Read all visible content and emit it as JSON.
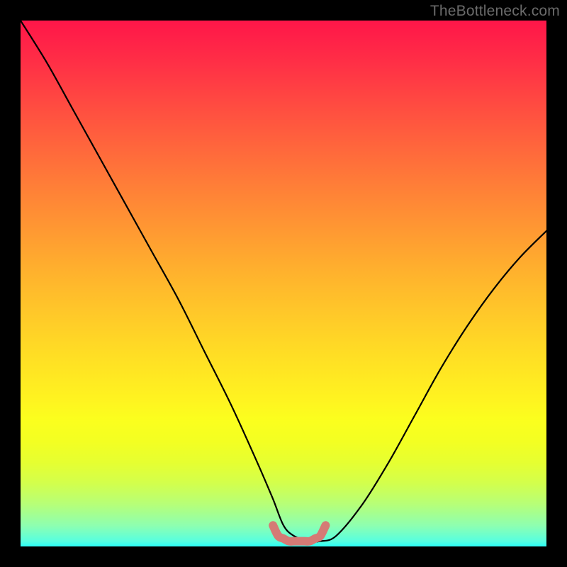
{
  "watermark": "TheBottleneck.com",
  "colors": {
    "frame": "#000000",
    "curve": "#000000",
    "bottom_hump": "#d57a75",
    "gradient_top": "#ff1649",
    "gradient_bottom": "#2cfff7"
  },
  "chart_data": {
    "type": "line",
    "title": "",
    "xlabel": "",
    "ylabel": "",
    "xlim": [
      0,
      100
    ],
    "ylim": [
      0,
      100
    ],
    "grid": false,
    "series": [
      {
        "name": "bottleneck-curve",
        "x": [
          0,
          5,
          10,
          15,
          20,
          25,
          30,
          35,
          40,
          45,
          48,
          50,
          52,
          55,
          57,
          60,
          65,
          70,
          75,
          80,
          85,
          90,
          95,
          100
        ],
        "values": [
          100,
          92,
          83,
          74,
          65,
          56,
          47,
          37,
          27,
          16,
          9,
          4,
          2,
          1,
          1,
          2,
          8,
          16,
          25,
          34,
          42,
          49,
          55,
          60
        ]
      },
      {
        "name": "bottom-hump",
        "x": [
          48,
          49,
          50,
          51,
          52,
          53,
          54,
          55,
          56,
          57,
          58
        ],
        "values": [
          4,
          2,
          1.5,
          1,
          1,
          1,
          1,
          1,
          1.5,
          2,
          4
        ]
      }
    ]
  }
}
